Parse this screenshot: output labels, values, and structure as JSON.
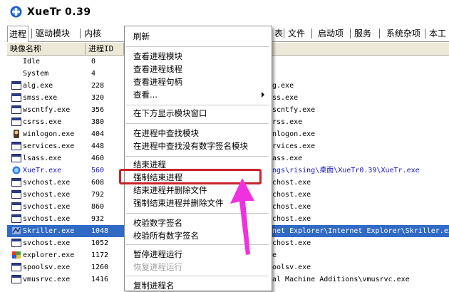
{
  "window": {
    "title": "XueTr 0.39",
    "accent": "#316ac5",
    "highlight": "#c8242a",
    "arrow": "#f031e0"
  },
  "tabs": [
    {
      "label": "进程",
      "selected": true
    },
    {
      "label": "驱动模块"
    },
    {
      "label": "内核"
    },
    {
      "label": "表"
    },
    {
      "label": "文件"
    },
    {
      "label": "启动项"
    },
    {
      "label": "服务"
    },
    {
      "label": "系统杂项"
    },
    {
      "label": "本工"
    }
  ],
  "table": {
    "columns": [
      "映像名称",
      "进程ID"
    ],
    "rows": [
      {
        "name": "Idle",
        "pid": "0",
        "path": "",
        "icon": "none"
      },
      {
        "name": "System",
        "pid": "4",
        "path": "",
        "icon": "none"
      },
      {
        "name": "alg.exe",
        "pid": "228",
        "path": "g.exe",
        "icon": "window-icon"
      },
      {
        "name": "smss.exe",
        "pid": "320",
        "path": "ss.exe",
        "icon": "window-icon"
      },
      {
        "name": "wscntfy.exe",
        "pid": "356",
        "path": "scntfy.exe",
        "icon": "window-icon"
      },
      {
        "name": "csrss.exe",
        "pid": "380",
        "path": "rss.exe",
        "icon": "window-icon"
      },
      {
        "name": "winlogon.exe",
        "pid": "404",
        "path": "nlogon.exe",
        "icon": "winlogon-icon"
      },
      {
        "name": "services.exe",
        "pid": "448",
        "path": "rvices.exe",
        "icon": "window-icon"
      },
      {
        "name": "lsass.exe",
        "pid": "460",
        "path": "ass.exe",
        "icon": "window-icon"
      },
      {
        "name": "XueTr.exe",
        "pid": "560",
        "path": "ngs\\rising\\桌面\\XueTr0.39\\XueTr.exe",
        "icon": "xuetr-icon",
        "style": "blue"
      },
      {
        "name": "svchost.exe",
        "pid": "608",
        "path": "chost.exe",
        "icon": "window-icon"
      },
      {
        "name": "svchost.exe",
        "pid": "792",
        "path": "chost.exe",
        "icon": "window-icon"
      },
      {
        "name": "svchost.exe",
        "pid": "860",
        "path": "chost.exe",
        "icon": "window-icon"
      },
      {
        "name": "svchost.exe",
        "pid": "932",
        "path": "chost.exe",
        "icon": "window-icon"
      },
      {
        "name": "Skriller.exe",
        "pid": "1048",
        "path": "net Explorer\\Internet Explorer\\Skriller.ex",
        "icon": "skriller-icon",
        "style": "sel"
      },
      {
        "name": "svchost.exe",
        "pid": "1052",
        "path": "chost.exe",
        "icon": "window-icon"
      },
      {
        "name": "explorer.exe",
        "pid": "1172",
        "path": "e",
        "icon": "explorer-icon"
      },
      {
        "name": "spoolsv.exe",
        "pid": "1260",
        "path": "oolsv.exe",
        "icon": "window-icon"
      },
      {
        "name": "vmusrvc.exe",
        "pid": "1416",
        "path": "al Machine Additions\\vmusrvc.exe",
        "icon": "window-icon"
      }
    ]
  },
  "context_menu": {
    "refresh": "刷新",
    "view_modules": "查看进程模块",
    "view_threads": "查看进程线程",
    "view_handles": "查看进程句柄",
    "view_more": "查看...",
    "show_module_window": "在下方显示模块窗口",
    "find_module": "在进程中查找模块",
    "find_unsigned_module": "在进程中查找没有数字签名模块",
    "end_process": "结束进程",
    "force_end_process": "强制结束进程",
    "end_and_delete": "结束进程并删除文件",
    "force_end_and_delete": "强制结束进程并删除文件",
    "verify_signature": "校验数字签名",
    "verify_all_signatures": "校验所有数字签名",
    "pause_process": "暂停进程运行",
    "resume_process": "恢复进程运行",
    "copy_process_name": "复制进程名"
  }
}
